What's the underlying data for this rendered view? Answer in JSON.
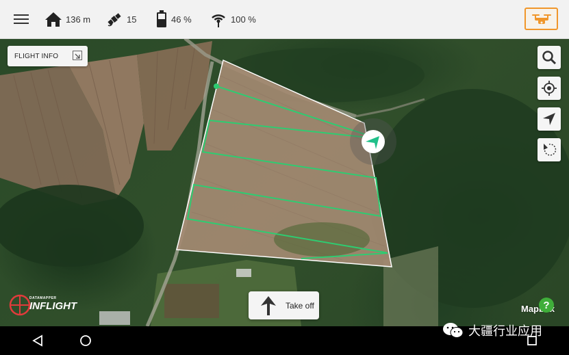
{
  "topbar": {
    "home_distance": "136 m",
    "satellites": "15",
    "battery": "46 %",
    "signal": "100 %",
    "accent_color": "#f0962a"
  },
  "map": {
    "flight_info_label": "FLIGHT INFO",
    "attribution": "Mapbox",
    "flight_line_color": "#2ecc71",
    "boundary_color": "#ffffff"
  },
  "takeoff": {
    "label": "Take off"
  },
  "logo": {
    "small_text": "DATAMAPPER",
    "big_text": "INFLIGHT"
  },
  "help": {
    "label": "?"
  },
  "watermark": {
    "text": "大疆行业应用"
  },
  "icons": {
    "menu": "menu-icon",
    "home": "home-icon",
    "satellite": "satellite-icon",
    "battery": "battery-icon",
    "signal": "signal-icon",
    "drone": "drone-icon",
    "search": "search-icon",
    "locate": "locate-icon",
    "navigate": "navigate-icon",
    "rotate": "rotate-icon",
    "expand": "expand-icon",
    "arrow_up": "arrow-up-icon"
  }
}
